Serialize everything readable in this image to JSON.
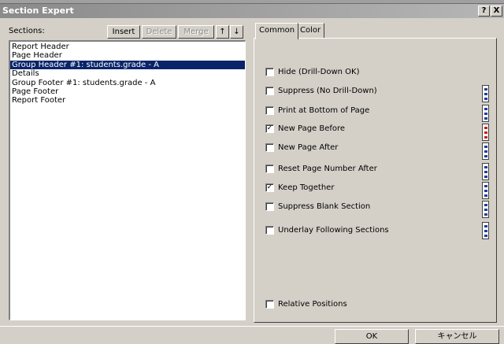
{
  "window": {
    "title": "Section Expert",
    "help_glyph": "?",
    "close_glyph": "X"
  },
  "left": {
    "sections_label": "Sections:",
    "buttons": {
      "insert": "Insert",
      "delete": "Delete",
      "merge": "Merge",
      "up_glyph": "↑",
      "down_glyph": "↓"
    },
    "sections": [
      "Report Header",
      "Page Header",
      "Group Header #1: students.grade - A",
      "Details",
      "Group Footer #1: students.grade - A",
      "Page Footer",
      "Report Footer"
    ],
    "selected_index": 2
  },
  "tabs": {
    "common": "Common",
    "color": "Color",
    "active": "Common"
  },
  "options": [
    {
      "label": "Hide (Drill-Down OK)",
      "checked": false
    },
    {
      "label": "Suppress (No Drill-Down)",
      "checked": false
    },
    {
      "label": "Print at Bottom of Page",
      "checked": false
    },
    {
      "label": "New Page Before",
      "checked": true
    },
    {
      "label": "New Page After",
      "checked": false
    },
    {
      "label": "Reset Page Number After",
      "checked": false
    },
    {
      "label": "Keep Together",
      "checked": true
    },
    {
      "label": "Suppress Blank Section",
      "checked": false
    },
    {
      "label": "Underlay Following Sections",
      "checked": false
    },
    {
      "label": "Relative Positions",
      "checked": false
    }
  ],
  "formula_icons": [
    {
      "name": "suppress-formula-icon",
      "active": false
    },
    {
      "name": "print-bottom-formula-icon",
      "active": false
    },
    {
      "name": "new-page-before-formula-icon",
      "active": true
    },
    {
      "name": "new-page-after-formula-icon",
      "active": false
    },
    {
      "name": "reset-page-formula-icon",
      "active": false
    },
    {
      "name": "keep-together-formula-icon",
      "active": false
    },
    {
      "name": "suppress-blank-formula-icon",
      "active": false
    },
    {
      "name": "underlay-formula-icon",
      "active": false
    }
  ],
  "footer": {
    "ok": "OK",
    "cancel": "キャンセル"
  },
  "colors": {
    "selection": "#0a246a",
    "face": "#d4d0c8",
    "formula_active": "#c8201c"
  }
}
